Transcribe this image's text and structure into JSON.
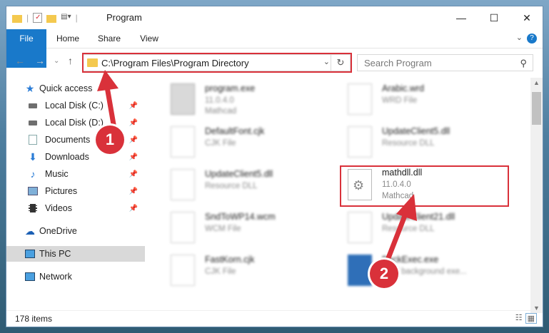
{
  "window": {
    "title": "Program"
  },
  "tabs": [
    "File",
    "Home",
    "Share",
    "View"
  ],
  "address": {
    "path": "C:\\Program Files\\Program Directory"
  },
  "search": {
    "placeholder": "Search Program"
  },
  "sidebar": {
    "items": [
      {
        "label": "Quick access",
        "icon": "star-icon"
      },
      {
        "label": "Local Disk (C:)",
        "icon": "disk-icon"
      },
      {
        "label": "Local Disk (D:)",
        "icon": "disk-icon"
      },
      {
        "label": "Documents",
        "icon": "documents-icon"
      },
      {
        "label": "Downloads",
        "icon": "download-icon"
      },
      {
        "label": "Music",
        "icon": "music-icon"
      },
      {
        "label": "Pictures",
        "icon": "pictures-icon"
      },
      {
        "label": "Videos",
        "icon": "videos-icon"
      },
      {
        "label": "OneDrive",
        "icon": "cloud-icon"
      },
      {
        "label": "This PC",
        "icon": "computer-icon"
      },
      {
        "label": "Network",
        "icon": "network-icon"
      }
    ]
  },
  "files": [
    {
      "name": "program.exe",
      "line2": "11.0.4.0",
      "line3": "Mathcad"
    },
    {
      "name": "Arabic.wrd",
      "line2": "WRD File",
      "line3": ""
    },
    {
      "name": "DefaultFont.cjk",
      "line2": "CJK File",
      "line3": ""
    },
    {
      "name": "UpdateClient5.dll",
      "line2": "Resource DLL",
      "line3": ""
    },
    {
      "name": "UpdateClient5.dll",
      "line2": "Resource DLL",
      "line3": ""
    },
    {
      "name": "mathdll.dll",
      "line2": "11.0.4.0",
      "line3": "Mathcad"
    },
    {
      "name": "SndToWP14.wcm",
      "line2": "WCM File",
      "line3": ""
    },
    {
      "name": "UpdateClient21.dll",
      "line2": "Resource DLL",
      "line3": ""
    },
    {
      "name": "FastKorn.cjk",
      "line2": "CJK File",
      "line3": ""
    },
    {
      "name": "BackExec.exe",
      "line2": "BGY background exe...",
      "line3": ""
    }
  ],
  "status": {
    "items": "178 items"
  },
  "callouts": [
    "1",
    "2"
  ],
  "colors": {
    "accent": "#1979ca",
    "highlight": "#d9313a"
  }
}
